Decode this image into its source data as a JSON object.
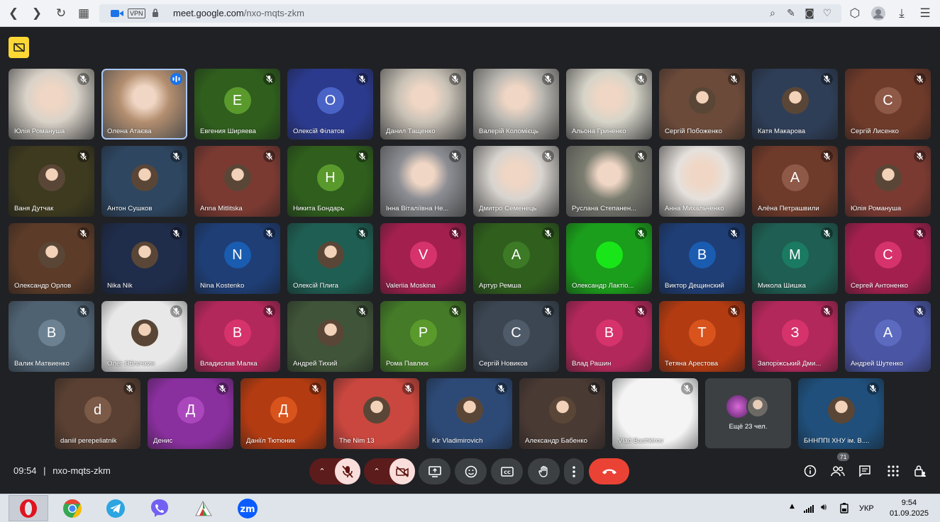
{
  "browser": {
    "url_host": "meet.google.com",
    "url_path": "/nxo-mqts-zkm",
    "vpn_label": "VPN",
    "icons": [
      "back-icon",
      "forward-icon",
      "reload-icon",
      "grid-icon",
      "camera-icon",
      "lock-icon",
      "search-icon",
      "edit-icon",
      "snapshot-icon",
      "heart-icon",
      "cube-icon",
      "profile-icon",
      "download-icon",
      "menu-icon"
    ]
  },
  "meeting": {
    "time": "09:54",
    "separator": "|",
    "code": "nxo-mqts-zkm",
    "participant_count": "71",
    "more_label": "Ещё 23 чел."
  },
  "tiles": [
    {
      "name": "Юлія Романуша",
      "kind": "cam",
      "bg": "#d9d2c8",
      "mic": "muted"
    },
    {
      "name": "Олена Атаєва",
      "kind": "cam",
      "bg": "#b38e6f",
      "mic": "speaking"
    },
    {
      "name": "Евгения Ширяева",
      "kind": "letter",
      "letter": "Е",
      "bg": "#2f5e1d",
      "av": "#5a9a2c",
      "mic": "muted"
    },
    {
      "name": "Олексій Філатов",
      "kind": "letter",
      "letter": "О",
      "bg": "#2b3a8c",
      "av": "#4a63c7",
      "mic": "muted"
    },
    {
      "name": "Данил Тащенко",
      "kind": "cam",
      "bg": "#c9c2b6",
      "mic": "muted"
    },
    {
      "name": "Валерій Коломієць",
      "kind": "cam",
      "bg": "#bcb9b3",
      "mic": "muted"
    },
    {
      "name": "Альона Гриненко",
      "kind": "cam",
      "bg": "#d6d4c8",
      "mic": "muted"
    },
    {
      "name": "Сергій Побоженко",
      "kind": "photo",
      "bg": "#6b4a3a",
      "mic": "muted"
    },
    {
      "name": "Катя Макарова",
      "kind": "photo",
      "bg": "#2f3e57",
      "mic": "muted"
    },
    {
      "name": "Сергій Лисенко",
      "kind": "letter",
      "letter": "С",
      "bg": "#6e3a2a",
      "av": "#8f5947",
      "mic": "muted"
    },
    {
      "name": "Ваня Дутчак",
      "kind": "photo",
      "bg": "#3d3a1f",
      "mic": "muted"
    },
    {
      "name": "Антон Сушков",
      "kind": "photo",
      "bg": "#2e4660",
      "mic": "muted"
    },
    {
      "name": "Anna Mitlitska",
      "kind": "photo",
      "bg": "#7a3a32",
      "mic": "muted"
    },
    {
      "name": "Никита Бондарь",
      "kind": "letter",
      "letter": "Н",
      "bg": "#2f5e1d",
      "av": "#5a9a2c",
      "mic": "muted"
    },
    {
      "name": "Інна Віталіївна Не...",
      "kind": "cam",
      "bg": "#8c8e94",
      "mic": "muted"
    },
    {
      "name": "Дмитро Семенець",
      "kind": "cam",
      "bg": "#d8d4cf",
      "mic": "muted"
    },
    {
      "name": "Руслана Степанен...",
      "kind": "cam",
      "bg": "#7b7d70",
      "mic": "muted"
    },
    {
      "name": "Анна Михальченко",
      "kind": "cam",
      "bg": "#e6e1dc",
      "mic": "none"
    },
    {
      "name": "Алёна Петрашвили",
      "kind": "letter",
      "letter": "А",
      "bg": "#6e3a2a",
      "av": "#8f5947",
      "mic": "muted"
    },
    {
      "name": "Юлія Романуша",
      "kind": "photo",
      "bg": "#7a3a32",
      "mic": "muted"
    },
    {
      "name": "Олександр Орлов",
      "kind": "photo",
      "bg": "#5c3b28",
      "mic": "muted"
    },
    {
      "name": "Nika Nik",
      "kind": "photo",
      "bg": "#1f2c4a",
      "mic": "muted"
    },
    {
      "name": "Nina Kostenko",
      "kind": "letter",
      "letter": "N",
      "bg": "#1f3e75",
      "av": "#1a5cb0",
      "mic": "muted"
    },
    {
      "name": "Олексій Плига",
      "kind": "photo",
      "bg": "#1f5e52",
      "mic": "muted"
    },
    {
      "name": "Valeriia Moskina",
      "kind": "letter",
      "letter": "V",
      "bg": "#a3204e",
      "av": "#d6336c",
      "mic": "muted"
    },
    {
      "name": "Артур Ремша",
      "kind": "letter",
      "letter": "А",
      "bg": "#2f5e1d",
      "av": "#3d7a26",
      "mic": "muted"
    },
    {
      "name": "Олександр Лактіо...",
      "kind": "letter",
      "letter": "",
      "bg": "#1b9e1b",
      "av": "#19e619",
      "mic": "muted"
    },
    {
      "name": "Виктор Дещинский",
      "kind": "letter",
      "letter": "В",
      "bg": "#1f3e75",
      "av": "#1a5cb0",
      "mic": "muted"
    },
    {
      "name": "Микола Шишка",
      "kind": "letter",
      "letter": "М",
      "bg": "#1f5e52",
      "av": "#1a7a62",
      "mic": "muted"
    },
    {
      "name": "Сергей Антоненко",
      "kind": "letter",
      "letter": "С",
      "bg": "#a3204e",
      "av": "#d6336c",
      "mic": "muted"
    },
    {
      "name": "Валик Матвиенко",
      "kind": "letter",
      "letter": "В",
      "bg": "#4f6272",
      "av": "#6c8293",
      "mic": "muted"
    },
    {
      "name": "Олег Яблочкин",
      "kind": "photo",
      "bg": "#e8e8e8",
      "mic": "muted"
    },
    {
      "name": "Владислав Малка",
      "kind": "letter",
      "letter": "В",
      "bg": "#b3285a",
      "av": "#d6336c",
      "mic": "muted"
    },
    {
      "name": "Андрей Тихий",
      "kind": "photo",
      "bg": "#3f5438",
      "mic": "muted"
    },
    {
      "name": "Рома Павлюк",
      "kind": "letter",
      "letter": "Р",
      "bg": "#447a28",
      "av": "#5a9a2c",
      "mic": "muted"
    },
    {
      "name": "Сергій Новиков",
      "kind": "letter",
      "letter": "С",
      "bg": "#3b4652",
      "av": "#4f5b68",
      "mic": "muted"
    },
    {
      "name": "Влад Рашин",
      "kind": "letter",
      "letter": "В",
      "bg": "#b3285a",
      "av": "#d6336c",
      "mic": "muted"
    },
    {
      "name": "Тетяна Арестова",
      "kind": "letter",
      "letter": "Т",
      "bg": "#b33b12",
      "av": "#d9541d",
      "mic": "muted"
    },
    {
      "name": "Запоріжський Дми...",
      "kind": "letter",
      "letter": "З",
      "bg": "#b3285a",
      "av": "#d6336c",
      "mic": "muted"
    },
    {
      "name": "Андрей Шутенко",
      "kind": "letter",
      "letter": "А",
      "bg": "#4a55a3",
      "av": "#5c6bc0",
      "mic": "muted"
    },
    {
      "name": "daniil perepeliatnik",
      "kind": "letter",
      "letter": "d",
      "bg": "#5a4032",
      "av": "#7b5a48",
      "mic": "muted"
    },
    {
      "name": "Денис",
      "kind": "letter",
      "letter": "Д",
      "bg": "#8a2f9e",
      "av": "#ab47bc",
      "mic": "muted"
    },
    {
      "name": "Даніїл Тютюник",
      "kind": "letter",
      "letter": "Д",
      "bg": "#b33b12",
      "av": "#d9541d",
      "mic": "muted"
    },
    {
      "name": "The Nim 13",
      "kind": "photo",
      "bg": "#c9473e",
      "mic": "muted"
    },
    {
      "name": "Kir Vladimirovich",
      "kind": "photo",
      "bg": "#2d4a77",
      "mic": "muted"
    },
    {
      "name": "Александр Бабенко",
      "kind": "photo",
      "bg": "#4a3a34",
      "mic": "muted"
    },
    {
      "name": "Vlad Bashkirov",
      "kind": "letter",
      "letter": "",
      "bg": "#f4f4f4",
      "av": "#f4f4f4",
      "mic": "muted"
    },
    {
      "name": "БННППІ ХНУ ім. В....",
      "kind": "photo",
      "bg": "#1f4f7a",
      "mic": "muted"
    }
  ],
  "taskbar": {
    "time": "9:54",
    "date": "01.09.2025",
    "lang": "УКР",
    "apps": [
      "opera-icon",
      "chrome-icon",
      "telegram-icon",
      "viber-icon",
      "mega-icon",
      "zoom-icon"
    ]
  },
  "colors": {
    "accent": "#ea4335",
    "muted_bg": "#5c1c1c",
    "meet_bg": "#202124"
  }
}
